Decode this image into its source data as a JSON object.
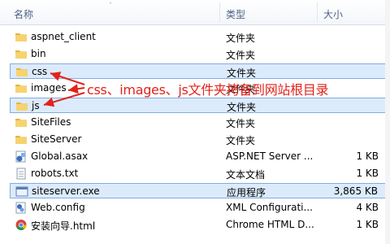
{
  "columns": {
    "name": "名称",
    "type": "类型",
    "size": "大小"
  },
  "files": [
    {
      "name": "aspnet_client",
      "type": "文件夹",
      "size": "",
      "icon": "folder-icon",
      "selected": false
    },
    {
      "name": "bin",
      "type": "文件夹",
      "size": "",
      "icon": "folder-icon",
      "selected": false
    },
    {
      "name": "css",
      "type": "文件夹",
      "size": "",
      "icon": "folder-icon",
      "selected": true
    },
    {
      "name": "images",
      "type": "文件夹",
      "size": "",
      "icon": "folder-icon",
      "selected": false
    },
    {
      "name": "js",
      "type": "文件夹",
      "size": "",
      "icon": "folder-icon",
      "selected": true
    },
    {
      "name": "SiteFiles",
      "type": "文件夹",
      "size": "",
      "icon": "folder-icon",
      "selected": false
    },
    {
      "name": "SiteServer",
      "type": "文件夹",
      "size": "",
      "icon": "folder-icon",
      "selected": false
    },
    {
      "name": "Global.asax",
      "type": "ASP.NET Server ...",
      "size": "1 KB",
      "icon": "aspx-file-icon",
      "selected": false
    },
    {
      "name": "robots.txt",
      "type": "文本文档",
      "size": "1 KB",
      "icon": "text-file-icon",
      "selected": false
    },
    {
      "name": "siteserver.exe",
      "type": "应用程序",
      "size": "3,865 KB",
      "icon": "exe-file-icon",
      "selected": true
    },
    {
      "name": "Web.config",
      "type": "XML Configurati...",
      "size": "4 KB",
      "icon": "config-file-icon",
      "selected": false
    },
    {
      "name": "安装向导.html",
      "type": "Chrome HTML D...",
      "size": "1 KB",
      "icon": "chrome-html-icon",
      "selected": false
    }
  ],
  "annotation": "css、images、js文件夹拷备到网站根目录",
  "colors": {
    "selection": "#dcebfc",
    "selection_border": "#84acdd",
    "annotation": "#e2231a",
    "folder": "#f2c24f"
  }
}
